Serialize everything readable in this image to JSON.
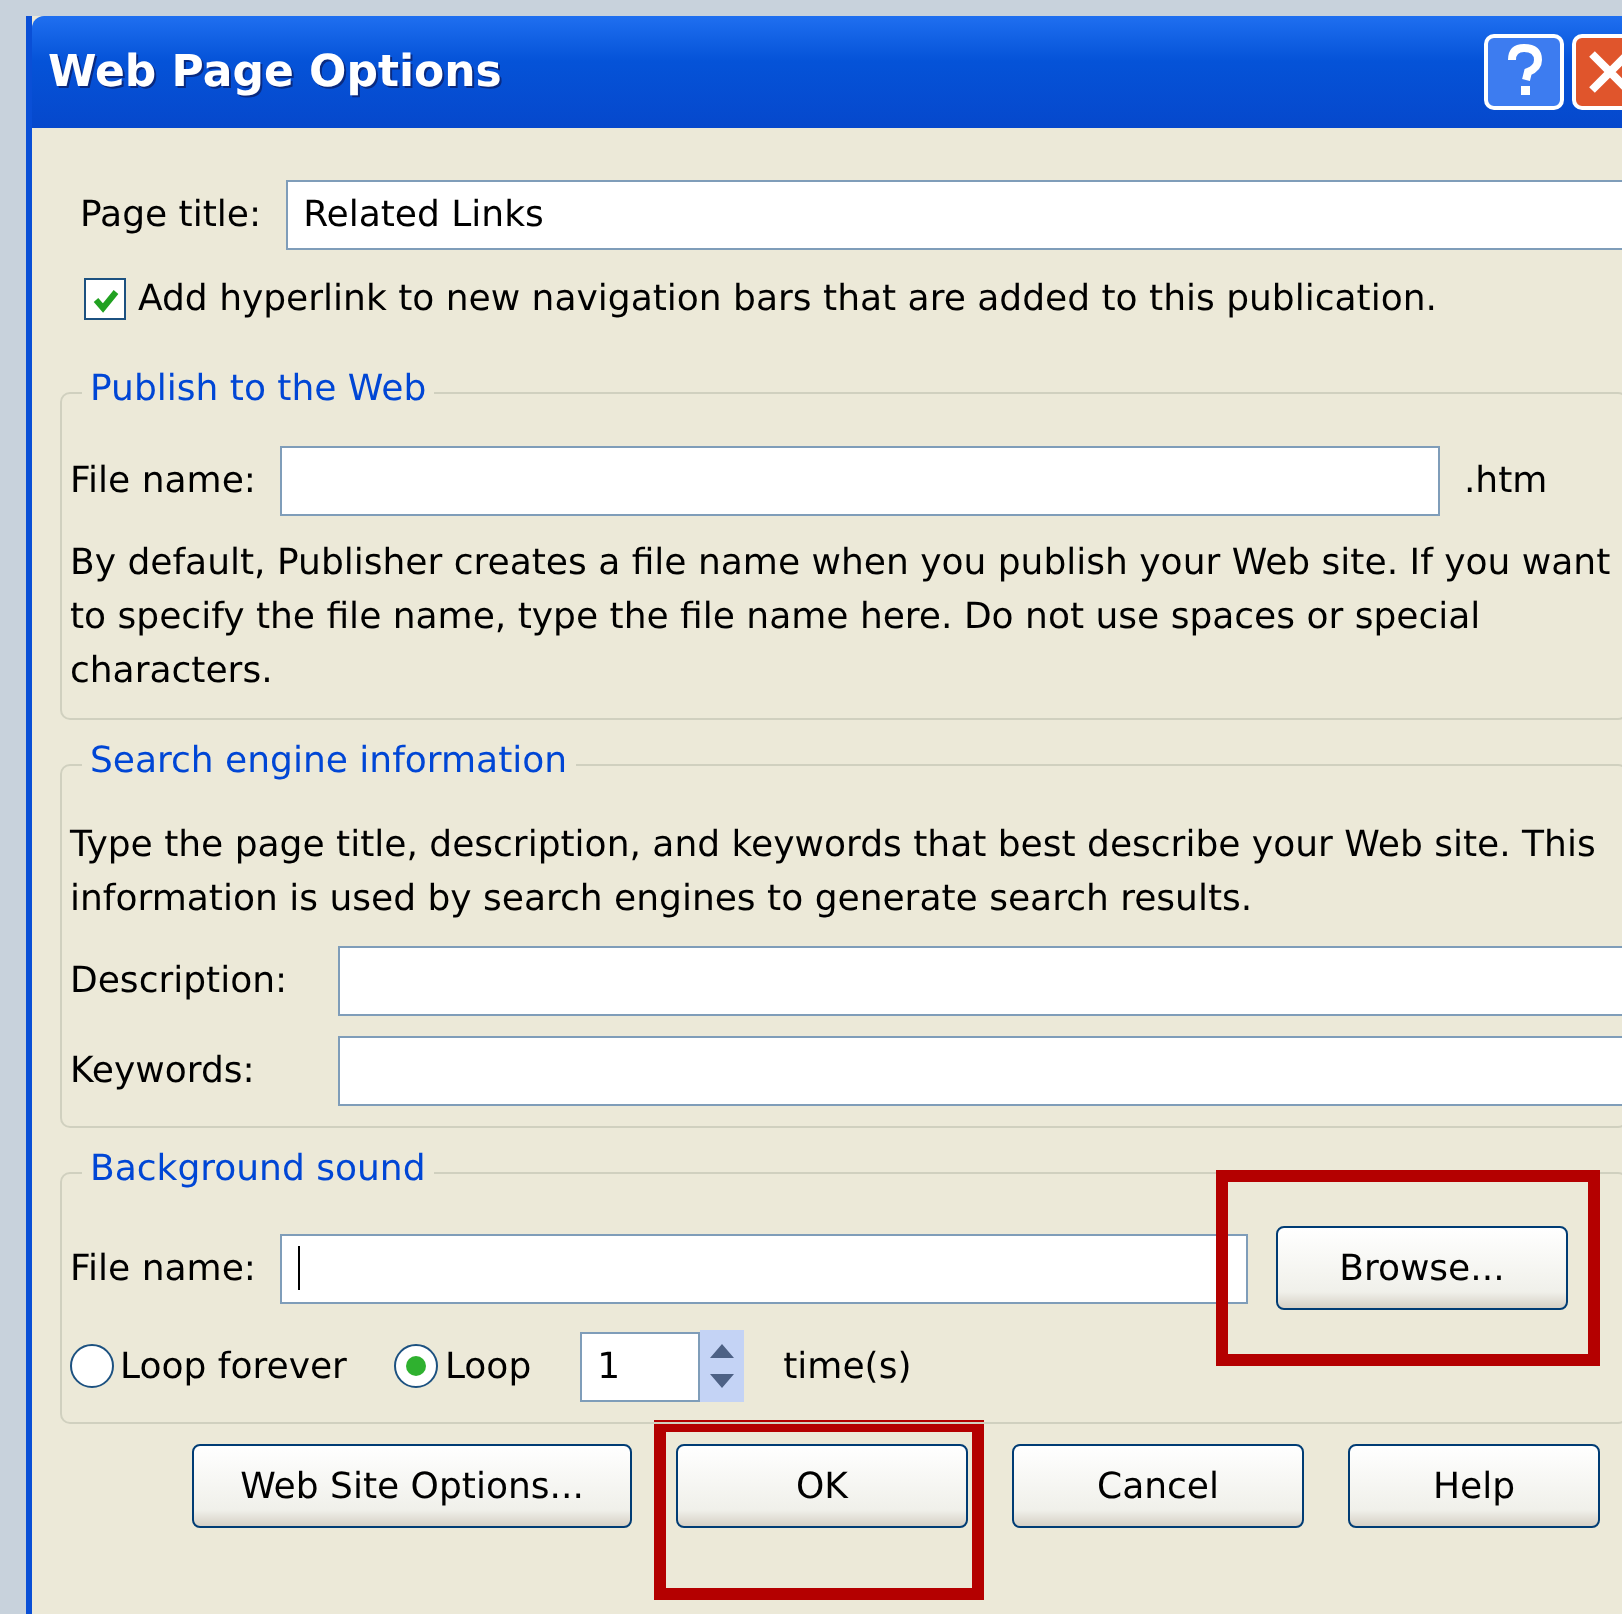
{
  "window": {
    "title": "Web Page Options"
  },
  "page_title": {
    "label": "Page title:",
    "value": "Related Links"
  },
  "add_hyperlink": {
    "label": "Add hyperlink to new navigation bars that are added to this publication.",
    "checked": true
  },
  "publish_group": {
    "title": "Publish to the Web",
    "file_label": "File name:",
    "suffix": ".htm",
    "note": "By default, Publisher creates a file name when you publish your Web site. If you want to specify the file name, type the file name here. Do not use spaces or special characters."
  },
  "search_group": {
    "title": "Search engine information",
    "note": "Type the page title, description, and keywords that best describe your Web site. This information is used by search engines to generate search results.",
    "fields": [
      {
        "label": "Description:"
      },
      {
        "label": "Keywords:"
      }
    ]
  },
  "sound_group": {
    "title": "Background sound",
    "file_label": "File name:",
    "browse": {
      "label": "Browse...",
      "highlighted": true
    },
    "loop_options": [
      {
        "label": "Loop forever",
        "selected": false
      },
      {
        "label": "Loop",
        "selected": true
      }
    ],
    "loop_count": "1",
    "times_label": "time(s)"
  },
  "buttons": [
    {
      "label": "Web Site Options...",
      "highlighted": false
    },
    {
      "label": "OK",
      "highlighted": true
    },
    {
      "label": "Cancel",
      "highlighted": false
    },
    {
      "label": "Help",
      "highlighted": false
    }
  ]
}
